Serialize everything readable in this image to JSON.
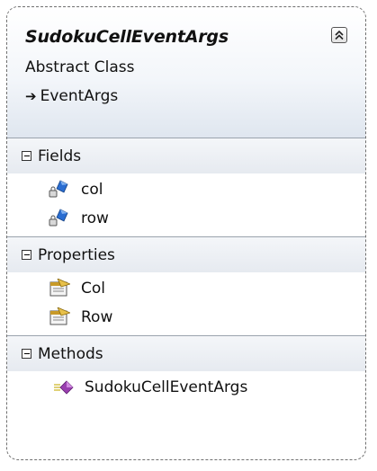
{
  "class_shape": {
    "name": "SudokuCellEventArgs",
    "stereotype": "Abstract Class",
    "base_class": "EventArgs",
    "icons": {
      "collapse": "double-chevron-up-icon",
      "inherit": "arrow-right-icon"
    }
  },
  "compartments": [
    {
      "title": "Fields",
      "items": [
        {
          "label": "col",
          "icon": "private-field-icon"
        },
        {
          "label": "row",
          "icon": "private-field-icon"
        }
      ]
    },
    {
      "title": "Properties",
      "items": [
        {
          "label": "Col",
          "icon": "property-icon"
        },
        {
          "label": "Row",
          "icon": "property-icon"
        }
      ]
    },
    {
      "title": "Methods",
      "items": [
        {
          "label": "SudokuCellEventArgs",
          "icon": "protected-method-icon"
        }
      ]
    }
  ],
  "colors": {
    "border": "#6f6f6f",
    "field_icon": "#2a6dd1",
    "property_icon": "#c89a28",
    "method_icon": "#9a3fb0"
  }
}
